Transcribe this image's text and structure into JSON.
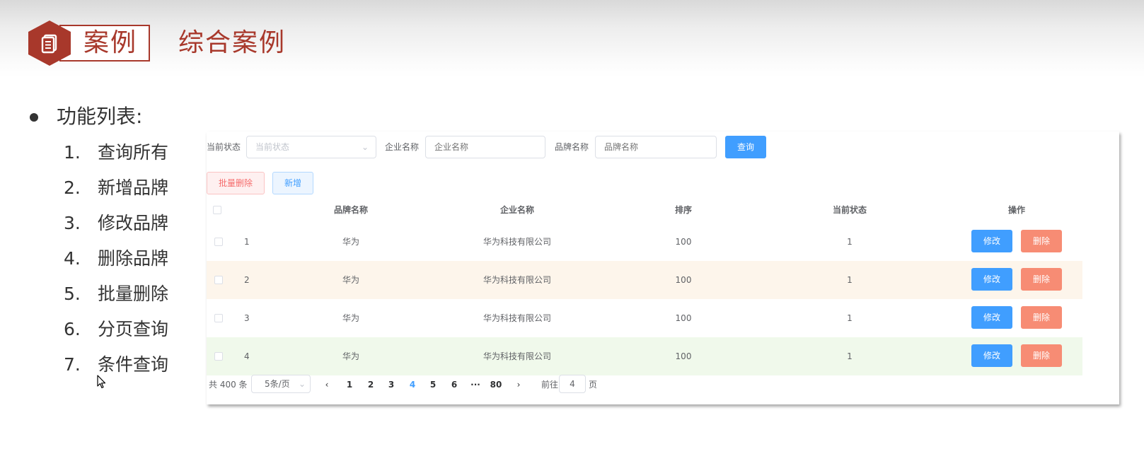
{
  "slide": {
    "badge_label": "案例",
    "title": "综合案例",
    "list_title": "功能列表:",
    "features": [
      {
        "num": "1.",
        "text": "查询所有"
      },
      {
        "num": "2.",
        "text": "新增品牌"
      },
      {
        "num": "3.",
        "text": "修改品牌"
      },
      {
        "num": "4.",
        "text": "删除品牌"
      },
      {
        "num": "5.",
        "text": "批量删除"
      },
      {
        "num": "6.",
        "text": "分页查询"
      },
      {
        "num": "7.",
        "text": "条件查询"
      }
    ],
    "accent_color": "#a8382b"
  },
  "search_form": {
    "status_label": "当前状态",
    "status_placeholder": "当前状态",
    "company_label": "企业名称",
    "company_placeholder": "企业名称",
    "brand_label": "品牌名称",
    "brand_placeholder": "品牌名称",
    "query_button": "查询"
  },
  "toolbar": {
    "batch_delete": "批量删除",
    "add_new": "新增"
  },
  "table": {
    "columns": [
      "品牌名称",
      "企业名称",
      "排序",
      "当前状态",
      "操作"
    ],
    "rows": [
      {
        "index": "1",
        "brand": "华为",
        "company": "华为科技有限公司",
        "ordered": "100",
        "status": "1"
      },
      {
        "index": "2",
        "brand": "华为",
        "company": "华为科技有限公司",
        "ordered": "100",
        "status": "1"
      },
      {
        "index": "3",
        "brand": "华为",
        "company": "华为科技有限公司",
        "ordered": "100",
        "status": "1"
      },
      {
        "index": "4",
        "brand": "华为",
        "company": "华为科技有限公司",
        "ordered": "100",
        "status": "1"
      }
    ],
    "edit_label": "修改",
    "delete_label": "删除",
    "row_colors": [
      "#ffffff",
      "#fdf5eb",
      "#ffffff",
      "#f0f9eb"
    ]
  },
  "pagination": {
    "total_text": "共 400 条",
    "page_size": "5条/页",
    "prev_icon": "chevron-left-icon",
    "pages": [
      "1",
      "2",
      "3",
      "4",
      "5",
      "6"
    ],
    "ellipsis": "···",
    "last_page": "80",
    "next_icon": "chevron-right-icon",
    "current_page": "4",
    "goto_label": "前往",
    "goto_value": "4",
    "page_suffix": "页"
  }
}
